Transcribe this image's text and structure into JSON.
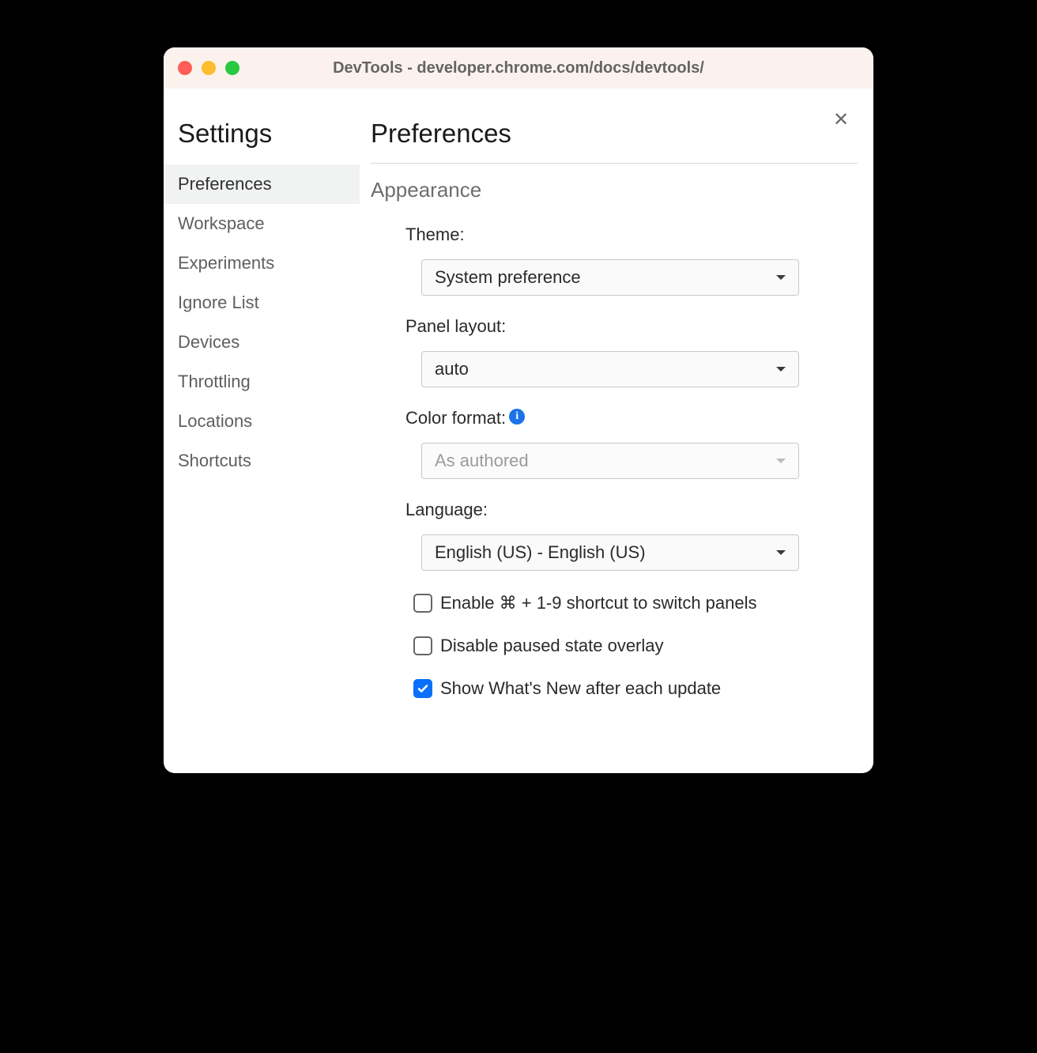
{
  "window": {
    "title": "DevTools - developer.chrome.com/docs/devtools/"
  },
  "sidebar": {
    "heading": "Settings",
    "items": [
      {
        "label": "Preferences",
        "active": true
      },
      {
        "label": "Workspace",
        "active": false
      },
      {
        "label": "Experiments",
        "active": false
      },
      {
        "label": "Ignore List",
        "active": false
      },
      {
        "label": "Devices",
        "active": false
      },
      {
        "label": "Throttling",
        "active": false
      },
      {
        "label": "Locations",
        "active": false
      },
      {
        "label": "Shortcuts",
        "active": false
      }
    ]
  },
  "main": {
    "heading": "Preferences",
    "section": "Appearance",
    "theme": {
      "label": "Theme:",
      "value": "System preference"
    },
    "panel_layout": {
      "label": "Panel layout:",
      "value": "auto"
    },
    "color_format": {
      "label": "Color format:",
      "value": "As authored",
      "disabled": true
    },
    "language": {
      "label": "Language:",
      "value": "English (US) - English (US)"
    },
    "checkboxes": [
      {
        "label": "Enable ⌘ + 1-9 shortcut to switch panels",
        "checked": false
      },
      {
        "label": "Disable paused state overlay",
        "checked": false
      },
      {
        "label": "Show What's New after each update",
        "checked": true
      }
    ]
  }
}
